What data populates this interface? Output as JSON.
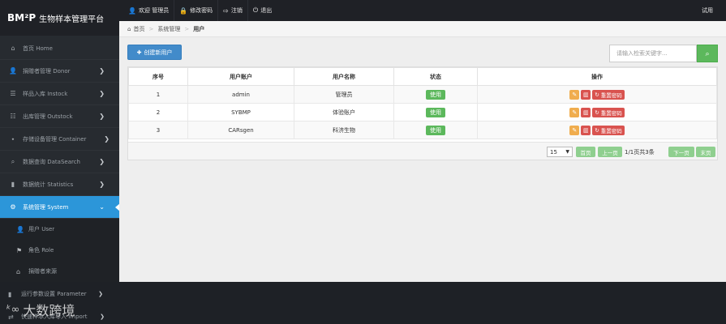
{
  "brand": {
    "logo": "BM²P",
    "title": "生物样本管理平台"
  },
  "topnav": [
    {
      "icon": "👤",
      "label": "欢迎 管理员"
    },
    {
      "icon": "🔒",
      "label": "修改密码"
    },
    {
      "icon": "⇨",
      "label": "注销"
    },
    {
      "icon": "⏻",
      "label": "退出"
    }
  ],
  "top_right": "试用",
  "breadcrumb": {
    "home": "首页",
    "parent": "系统管理",
    "current": "用户"
  },
  "sidebar": {
    "items": [
      {
        "icon": "⌂",
        "label": "首页 Home"
      },
      {
        "icon": "👤",
        "label": "捐赠者管理 Donor"
      },
      {
        "icon": "☰",
        "label": "样品入库 Instock"
      },
      {
        "icon": "☷",
        "label": "出库管理 Outstock"
      },
      {
        "icon": "⬩",
        "label": "存储设备管理 Container"
      },
      {
        "icon": "⌕",
        "label": "数据查询 DataSearch"
      },
      {
        "icon": "▮",
        "label": "数据统计 Statistics"
      },
      {
        "icon": "⚙",
        "label": "系统管理 System"
      }
    ],
    "subitems": [
      {
        "icon": "👤",
        "label": "用户 User"
      },
      {
        "icon": "⚑",
        "label": "角色 Role"
      },
      {
        "icon": "⌂",
        "label": "捐赠者来源"
      }
    ],
    "bottom_items": [
      {
        "icon": "▮",
        "label": "运行参数设置 Parameter"
      },
      {
        "icon": "⇄",
        "label": "快速样本入库导入 Import"
      }
    ]
  },
  "watermark": {
    "logo": "ᵏ∞",
    "text": "大数跨境"
  },
  "toolbar": {
    "create_label": "创建新用户",
    "search_placeholder": "请输入检索关键字..."
  },
  "table": {
    "headers": [
      "序号",
      "用户账户",
      "用户名称",
      "状态",
      "操作"
    ],
    "rows": [
      {
        "no": "1",
        "account": "admin",
        "name": "管理员",
        "status": "使用"
      },
      {
        "no": "2",
        "account": "SYBMP",
        "name": "体验账户",
        "status": "使用"
      },
      {
        "no": "3",
        "account": "CARsgen",
        "name": "科济生物",
        "status": "使用"
      }
    ],
    "reset_label": "重置密码"
  },
  "pager": {
    "page_size": "15",
    "first": "首页",
    "prev": "上一页",
    "info": "1/1页共3条",
    "next": "下一页",
    "last": "末页"
  },
  "colors": {
    "accent": "#2c96d9",
    "primary_button": "#428bca",
    "success": "#5cb85c",
    "warning": "#f0ad4e",
    "danger": "#d9534f",
    "sidebar_bg": "#272b30"
  }
}
